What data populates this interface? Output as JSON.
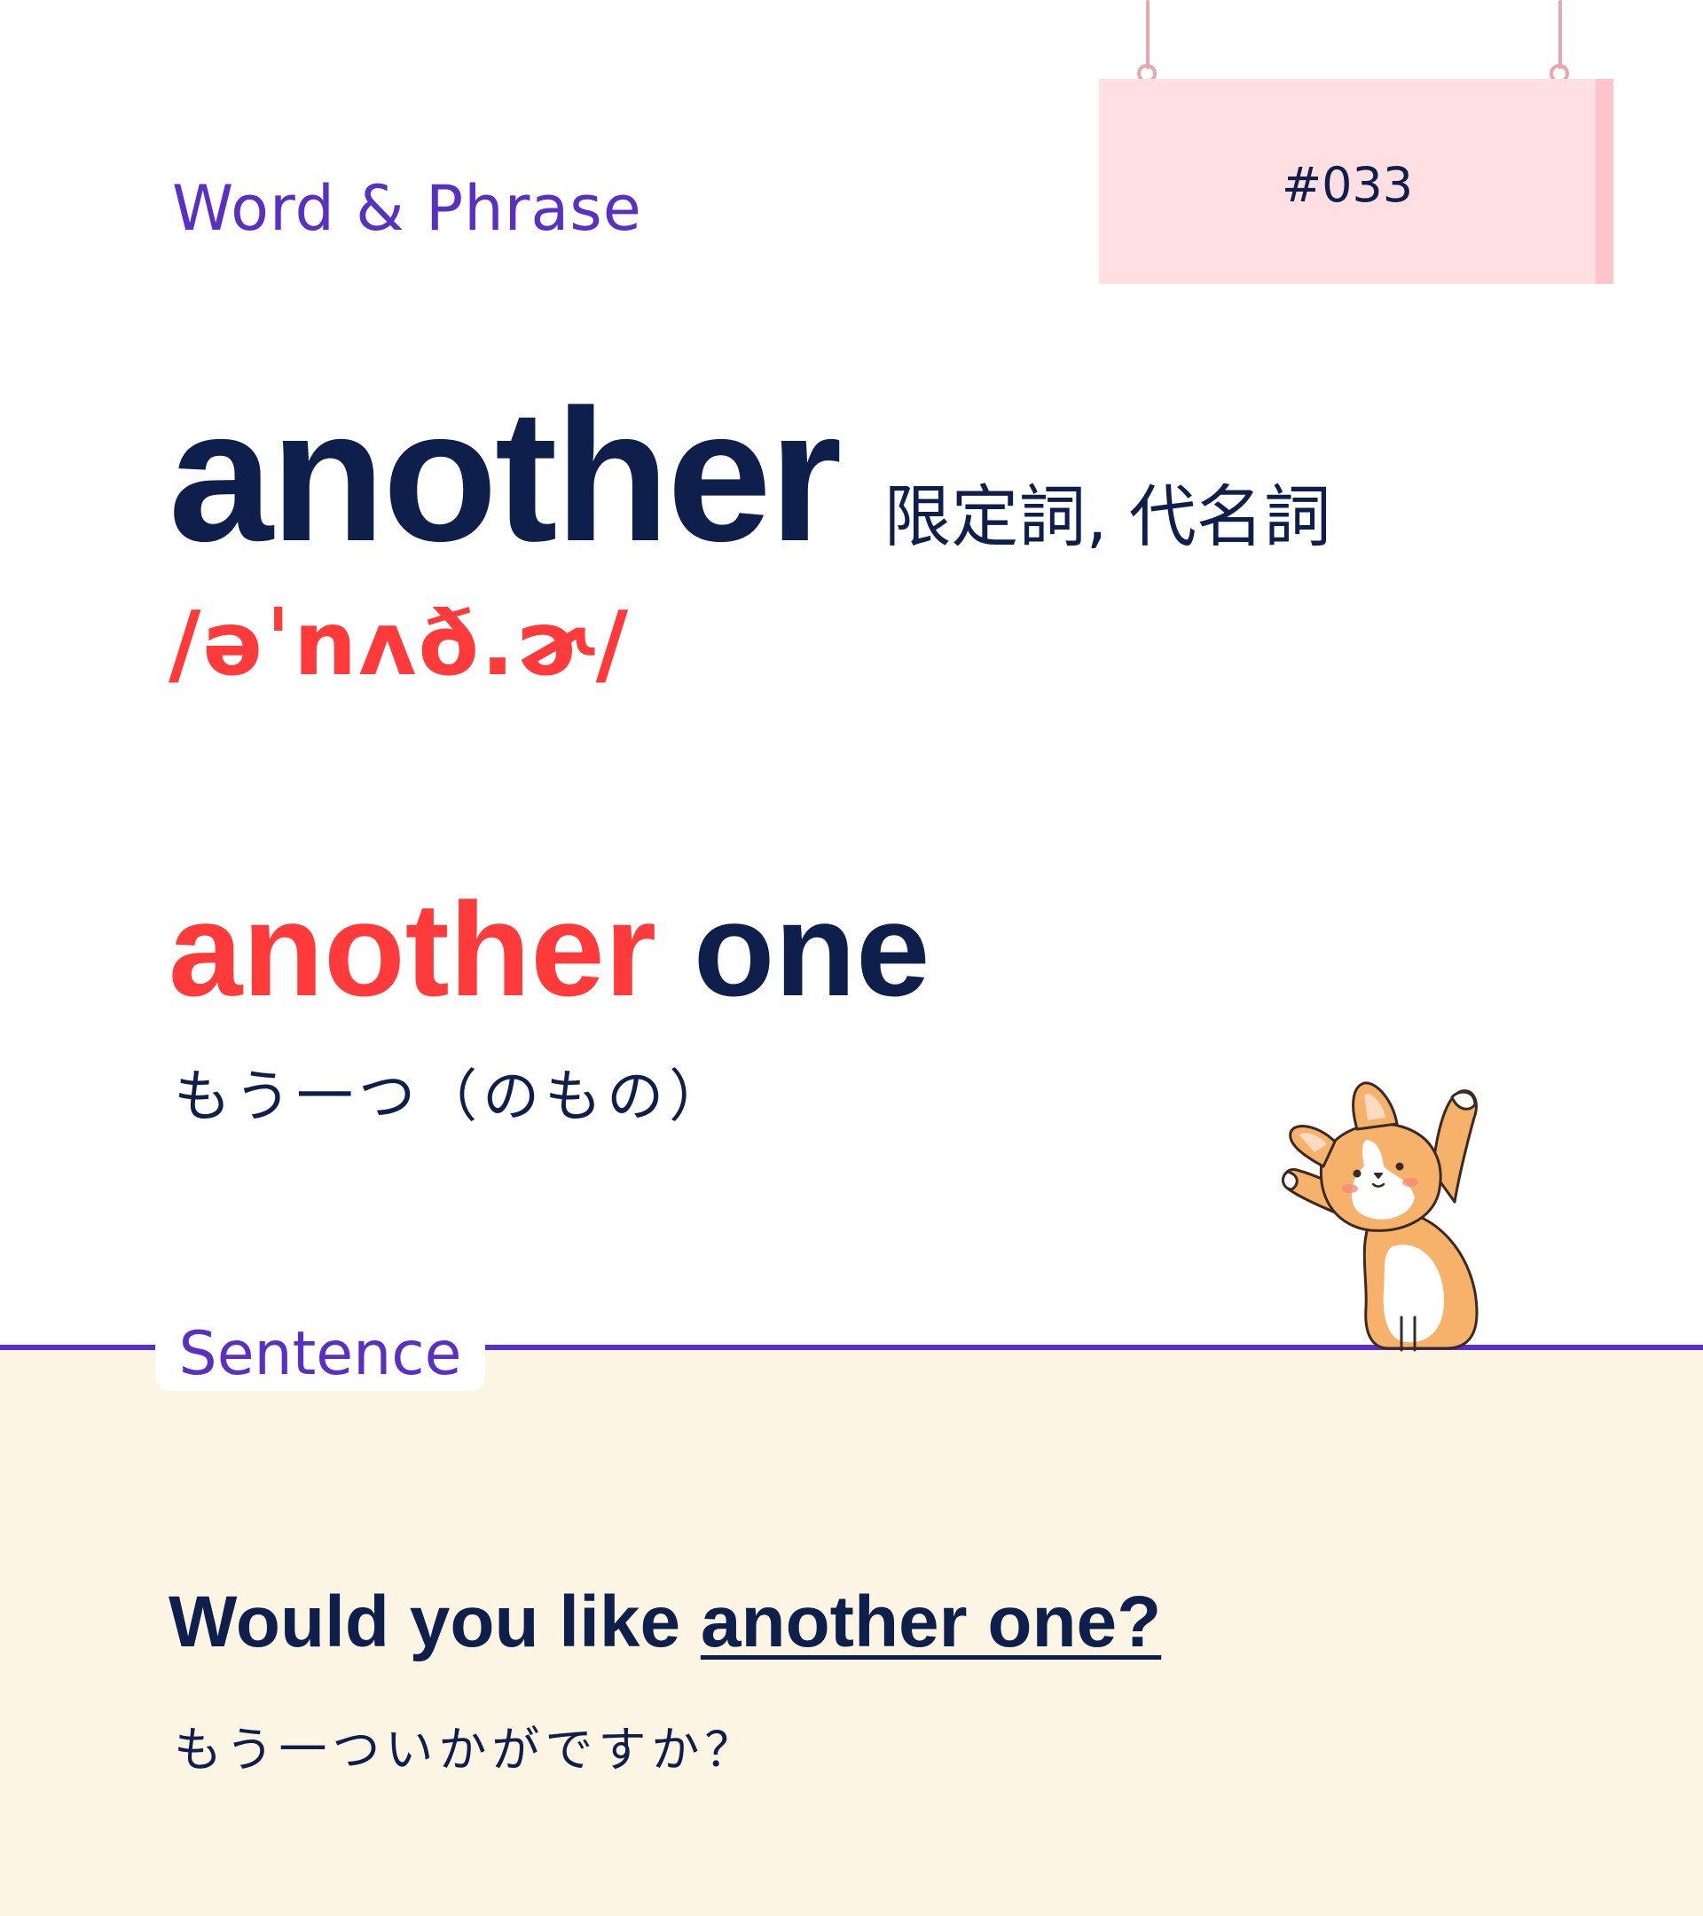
{
  "header": {
    "section_label": "Word & Phrase",
    "card_number": "#033"
  },
  "entry": {
    "headword": "another",
    "part_of_speech": "限定詞, 代名詞",
    "pronunciation": "/əˈnʌð.ɚ/"
  },
  "phrase": {
    "highlight": "another",
    "rest": "one",
    "translation": "もう一つ（のもの）"
  },
  "sentence_section": {
    "label": "Sentence",
    "lead": "Would you like ",
    "underlined": "another one?",
    "translation": "もう一ついかがですか？"
  },
  "illustration": {
    "name": "corgi-stretching-icon"
  },
  "colors": {
    "accent_purple": "#5a2fc4",
    "highlight_red": "#ff3a3a",
    "text_navy": "#0f1f4b",
    "sign_pink": "#ffdfe2",
    "bottom_cream": "#fdf5e3"
  }
}
